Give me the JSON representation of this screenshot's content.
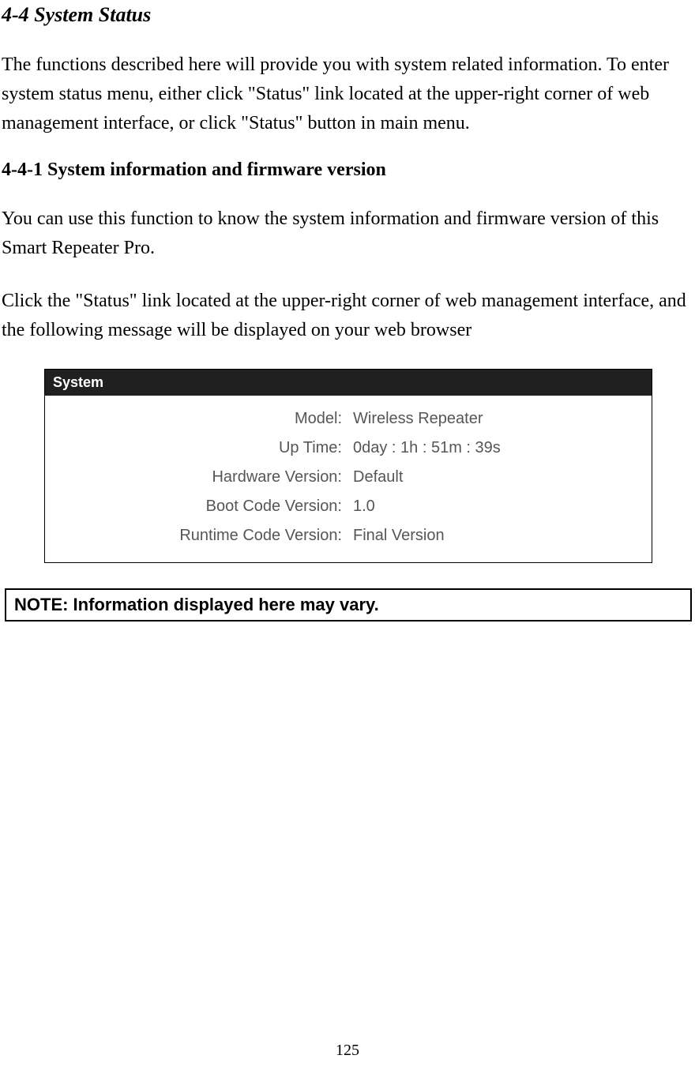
{
  "headings": {
    "main": "4-4 System Status",
    "sub": "4-4-1 System information and firmware version"
  },
  "paragraphs": {
    "intro": "The functions described here will provide you with system related information. To enter system status menu, either click \"Status\" link located at the upper-right corner of web management interface, or click \"Status\" button in main menu.",
    "p1": "You can use this function to know the system information and firmware version of this Smart Repeater Pro.",
    "p2": "Click the \"Status\" link located at the upper-right corner of web management interface, and the following message will be displayed on your web browser"
  },
  "system_panel": {
    "title": "System",
    "rows": [
      {
        "label": "Model:",
        "value": "Wireless Repeater"
      },
      {
        "label": "Up Time:",
        "value": "0day : 1h : 51m : 39s"
      },
      {
        "label": "Hardware Version:",
        "value": "Default"
      },
      {
        "label": "Boot Code Version:",
        "value": "1.0"
      },
      {
        "label": "Runtime Code Version:",
        "value": "Final Version"
      }
    ]
  },
  "note": "NOTE: Information displayed here may vary.",
  "page_number": "125"
}
